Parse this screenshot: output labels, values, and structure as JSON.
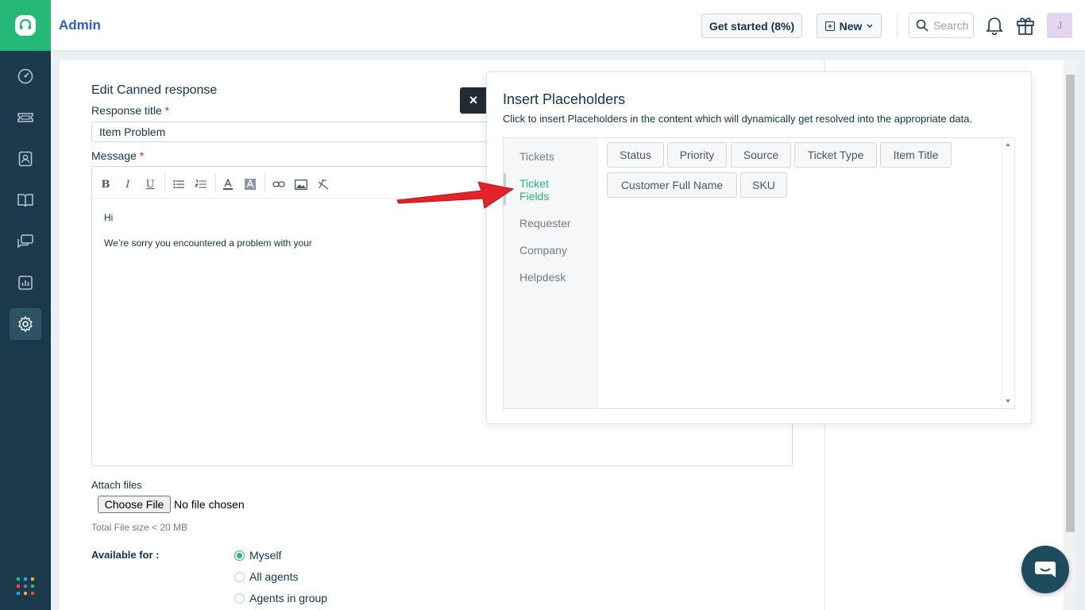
{
  "header": {
    "title": "Admin",
    "get_started": "Get started (8%)",
    "new_label": "New",
    "search_placeholder": "Search",
    "avatar_initial": "J"
  },
  "form": {
    "title": "Edit Canned response",
    "response_title_label": "Response title",
    "response_title_value": "Item Problem",
    "message_label": "Message",
    "required_mark": "*",
    "message_lines": [
      "Hi",
      "We’re sorry you encountered a problem with your"
    ],
    "attach_label": "Attach files",
    "choose_file": "Choose File",
    "no_file": "No file chosen",
    "file_size": "Total File size < 20 MB",
    "available_label": "Available for :",
    "available_options": [
      {
        "label": "Myself",
        "selected": true
      },
      {
        "label": "All agents",
        "selected": false
      },
      {
        "label": "Agents in group",
        "selected": false
      }
    ]
  },
  "popup": {
    "close": "×",
    "title": "Insert Placeholders",
    "subtitle": "Click to insert Placeholders in the content which will dynamically get resolved into the appropriate data.",
    "categories": [
      "Tickets",
      "Ticket Fields",
      "Requester",
      "Company",
      "Helpdesk"
    ],
    "active_category": "Ticket Fields",
    "placeholders": [
      "Status",
      "Priority",
      "Source",
      "Ticket Type",
      "Item Title",
      "Customer Full Name",
      "SKU"
    ]
  },
  "colors": {
    "brand_green": "#25b979",
    "nav_bg": "#1b3a4b",
    "arrow_red": "#e3222a"
  },
  "icons": {
    "nav": [
      "dashboard-icon",
      "tickets-icon",
      "contacts-icon",
      "solutions-icon",
      "forums-icon",
      "reports-icon",
      "admin-gear-icon"
    ]
  }
}
